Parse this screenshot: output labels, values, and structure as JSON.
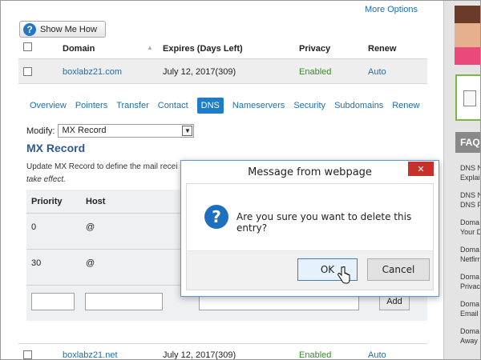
{
  "header": {
    "more_options": "More Options",
    "show_me_how": "Show Me How"
  },
  "domains_table": {
    "columns": {
      "domain": "Domain",
      "expires": "Expires (Days Left)",
      "privacy": "Privacy",
      "renew": "Renew"
    },
    "rows": [
      {
        "domain": "boxlabz21.com",
        "expires": "July 12, 2017(309)",
        "privacy": "Enabled",
        "renew": "Auto"
      },
      {
        "domain": "boxlabz21.net",
        "expires": "July 12, 2017(309)",
        "privacy": "Enabled",
        "renew": "Auto"
      }
    ]
  },
  "tabs": [
    "Overview",
    "Pointers",
    "Transfer",
    "Contact",
    "DNS",
    "Nameservers",
    "Security",
    "Subdomains",
    "Renew"
  ],
  "active_tab": "DNS",
  "modify": {
    "label": "Modify:",
    "selected": "MX Record"
  },
  "mx": {
    "title": "MX Record",
    "desc_line1": "Update MX Record to define the mail recei",
    "desc_line2": "take effect.",
    "columns": {
      "priority": "Priority",
      "host": "Host"
    },
    "rows": [
      {
        "priority": "0",
        "host": "@"
      },
      {
        "priority": "30",
        "host": "@"
      }
    ],
    "add_button": "Add"
  },
  "sidebar": {
    "faq_label": "FAQ",
    "faq_items": [
      [
        "DNS N",
        "Explai"
      ],
      [
        "DNS N",
        "DNS F"
      ],
      [
        "Doma",
        "Your D"
      ],
      [
        "Doma",
        "Netfirr"
      ],
      [
        "Doma",
        "Privac"
      ],
      [
        "Doma",
        "Email"
      ],
      [
        "Doma",
        "Away"
      ]
    ]
  },
  "dialog": {
    "title": "Message from webpage",
    "close_glyph": "✕",
    "message": "Are you sure you want to delete this entry?",
    "ok": "OK",
    "cancel": "Cancel"
  },
  "colors": {
    "link": "#1a6fb3",
    "accent": "#1e7dc4",
    "enabled": "#3a8a2a",
    "close": "#c7302b",
    "mx_title": "#2e5a8f"
  }
}
